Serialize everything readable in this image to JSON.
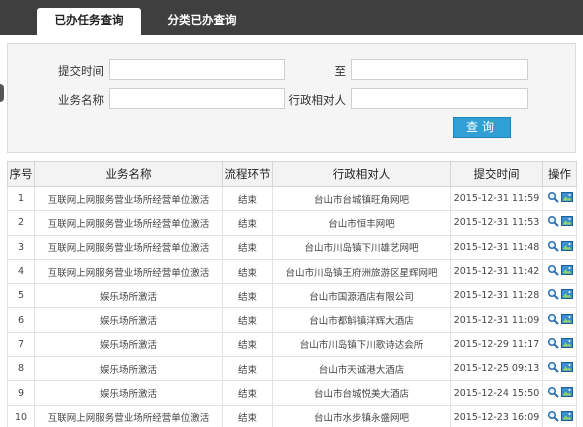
{
  "tabs": [
    {
      "label": "已办任务查询",
      "active": true
    },
    {
      "label": "分类已办查询",
      "active": false
    }
  ],
  "search": {
    "submit_time_label": "提交时间",
    "to_label": "至",
    "business_name_label": "业务名称",
    "counterpart_label": "行政相对人",
    "submit_time_from": "",
    "submit_time_to": "",
    "business_name": "",
    "counterpart": "",
    "query_button": "查询"
  },
  "table": {
    "columns": [
      "序号",
      "业务名称",
      "流程环节",
      "行政相对人",
      "提交时间",
      "操作"
    ],
    "rows": [
      [
        "1",
        "互联网上网服务营业场所经营单位激活",
        "结束",
        "台山市台城镇旺角网吧",
        "2015-12-31 11:59"
      ],
      [
        "2",
        "互联网上网服务营业场所经营单位激活",
        "结束",
        "台山市恒丰网吧",
        "2015-12-31 11:53"
      ],
      [
        "3",
        "互联网上网服务营业场所经营单位激活",
        "结束",
        "台山市川岛镇下川雄艺网吧",
        "2015-12-31 11:48"
      ],
      [
        "4",
        "互联网上网服务营业场所经营单位激活",
        "结束",
        "台山市川岛镇王府洲旅游区星辉网吧",
        "2015-12-31 11:42"
      ],
      [
        "5",
        "娱乐场所激活",
        "结束",
        "台山市国源酒店有限公司",
        "2015-12-31 11:28"
      ],
      [
        "6",
        "娱乐场所激活",
        "结束",
        "台山市都斛镇洋辉大酒店",
        "2015-12-31 11:09"
      ],
      [
        "7",
        "娱乐场所激活",
        "结束",
        "台山市川岛镇下川歌诗达会所",
        "2015-12-29 11:17"
      ],
      [
        "8",
        "娱乐场所激活",
        "结束",
        "台山市天诚港大酒店",
        "2015-12-25 09:13"
      ],
      [
        "9",
        "娱乐场所激活",
        "结束",
        "台山市台城悦美大酒店",
        "2015-12-24 15:50"
      ],
      [
        "10",
        "互联网上网服务营业场所经营单位激活",
        "结束",
        "台山市水步镇永盛网吧",
        "2015-12-23 16:09"
      ]
    ],
    "action_icons": [
      "magnifier-icon",
      "image-icon"
    ]
  },
  "colors": {
    "tabbar": "#3f3f3f",
    "query_button": "#2f9fd6",
    "panel": "#f5f5f5"
  }
}
